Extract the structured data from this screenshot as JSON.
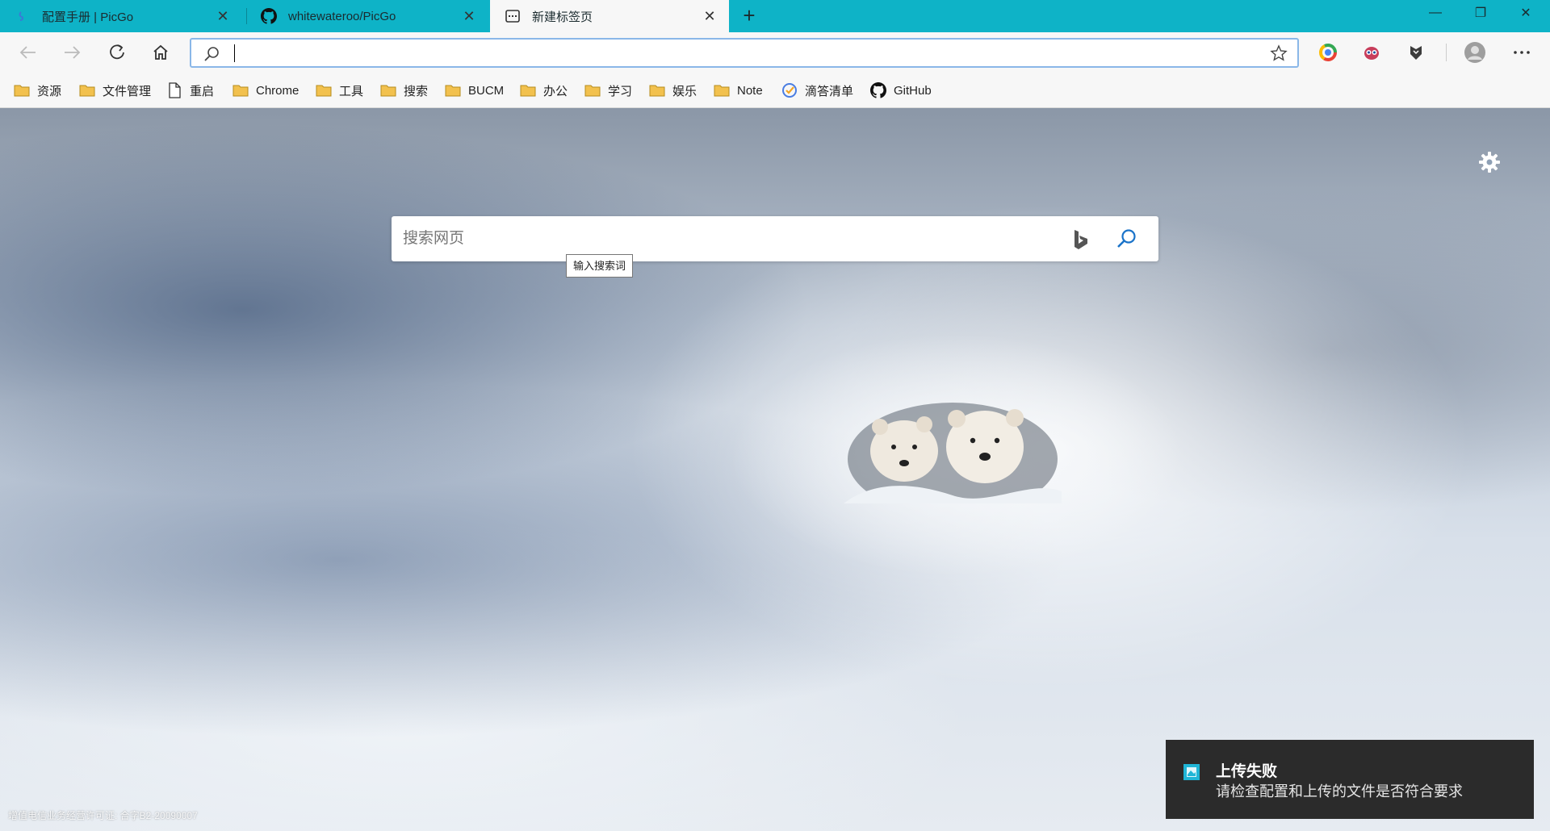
{
  "tabs": [
    {
      "label": "配置手册 | PicGo",
      "icon": "picgo-icon",
      "close": "✕"
    },
    {
      "label": "whitewateroo/PicGo",
      "icon": "github-icon",
      "close": "✕"
    },
    {
      "label": "新建标签页",
      "icon": "newtab-page-icon",
      "close": "✕"
    }
  ],
  "new_tab_button": "+",
  "window_controls": {
    "minimize": "—",
    "restore": "❐",
    "close": "✕"
  },
  "address_bar": {
    "value": "",
    "placeholder": ""
  },
  "bookmarks": [
    {
      "label": "资源",
      "icon": "folder-icon"
    },
    {
      "label": "文件管理",
      "icon": "folder-icon"
    },
    {
      "label": "重启",
      "icon": "page-icon"
    },
    {
      "label": "Chrome",
      "icon": "folder-icon"
    },
    {
      "label": "工具",
      "icon": "folder-icon"
    },
    {
      "label": "搜索",
      "icon": "folder-icon"
    },
    {
      "label": "BUCM",
      "icon": "folder-icon"
    },
    {
      "label": "办公",
      "icon": "folder-icon"
    },
    {
      "label": "学习",
      "icon": "folder-icon"
    },
    {
      "label": "娱乐",
      "icon": "folder-icon"
    },
    {
      "label": "Note",
      "icon": "folder-icon"
    },
    {
      "label": "滴答清单",
      "icon": "check-icon"
    },
    {
      "label": "GitHub",
      "icon": "github-icon"
    }
  ],
  "search": {
    "placeholder": "搜索网页",
    "tooltip": "输入搜索词"
  },
  "footer": "增值电信业务经营许可证: 合字B2-20090007",
  "toast": {
    "title": "上传失败",
    "message": "请检查配置和上传的文件是否符合要求"
  },
  "colors": {
    "titlebar": "#0eb3c7",
    "toolbar": "#f7f7f7",
    "accent": "#1a73c9",
    "folder": "#f2c14e",
    "toast_bg": "#2b2b2b"
  }
}
